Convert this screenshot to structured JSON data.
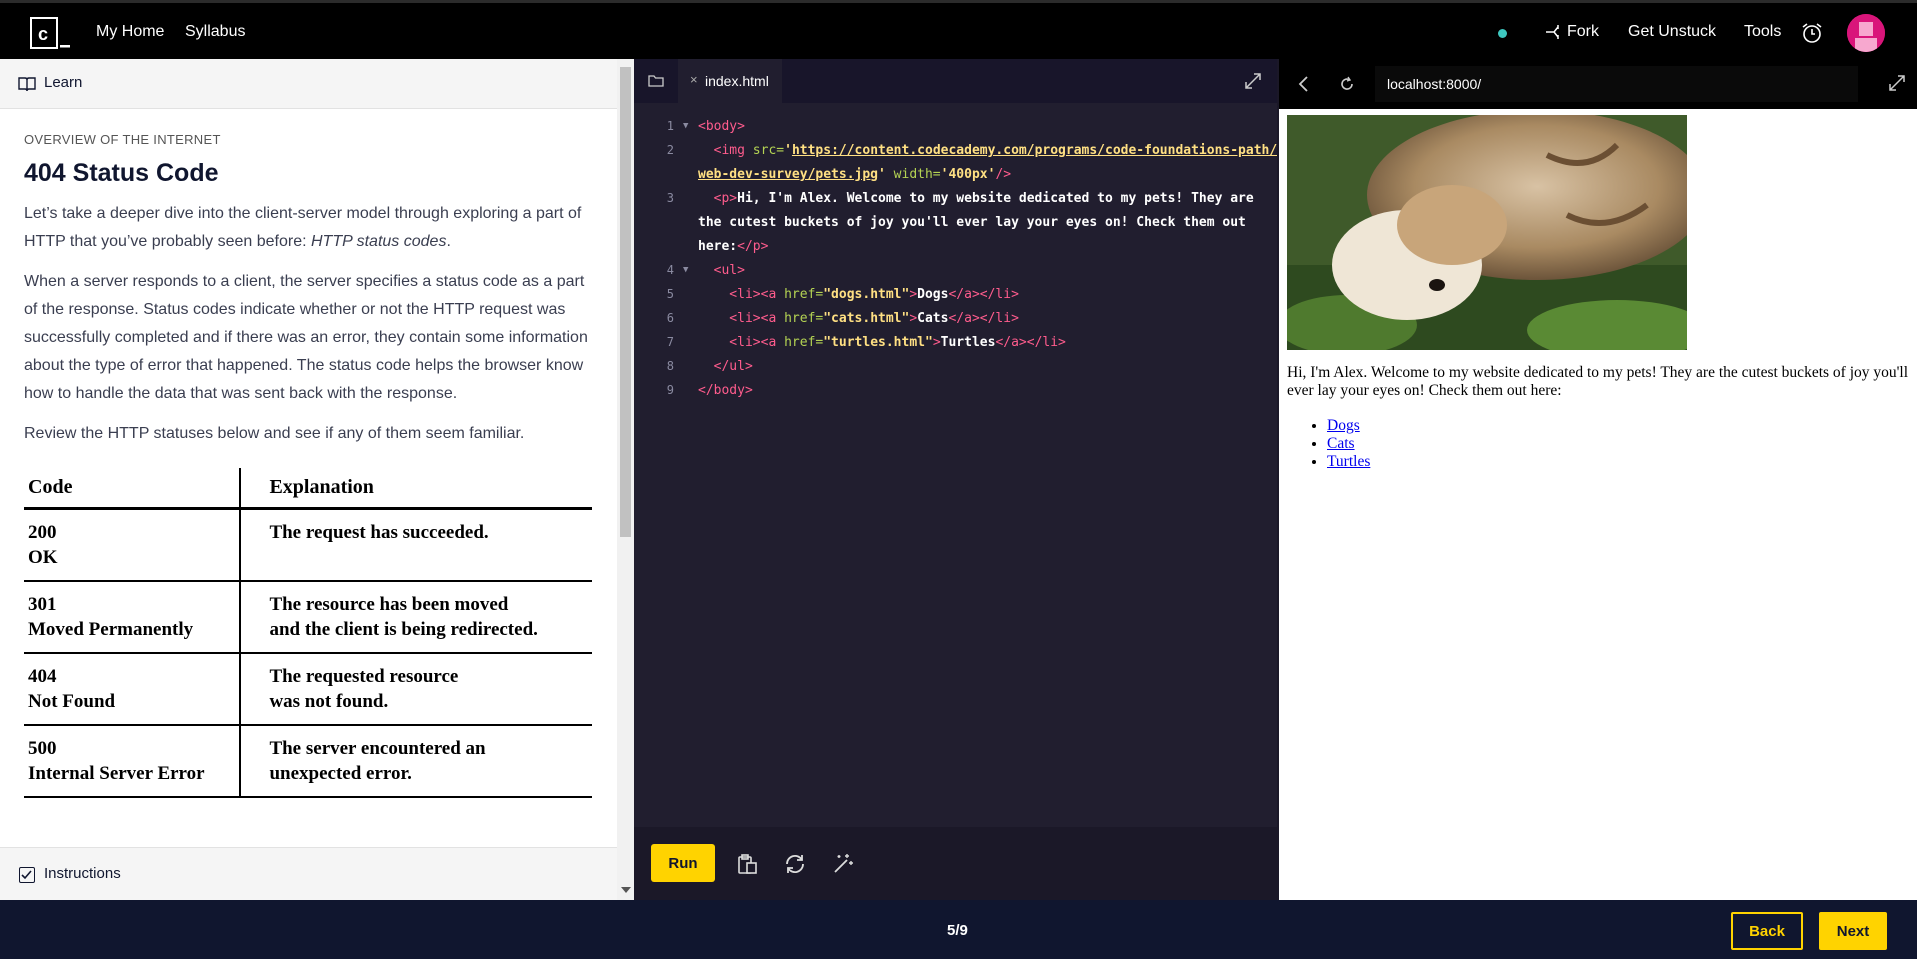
{
  "topbar": {
    "nav": {
      "home": "My Home",
      "syllabus": "Syllabus"
    },
    "actions": {
      "fork": "Fork",
      "unstuck": "Get Unstuck",
      "tools": "Tools"
    },
    "icons": [
      "codecademy-logo-icon",
      "fork-icon",
      "alarm-icon",
      "avatar"
    ],
    "status_color": "#3ec8c0"
  },
  "learn": {
    "header": "Learn",
    "section": "OVERVIEW OF THE INTERNET",
    "title": "404 Status Code",
    "para1_pre": "Let’s take a deeper dive into the client-server model through exploring a part of HTTP that you’ve probably seen before: ",
    "para1_em": "HTTP status codes",
    "para1_post": ".",
    "para2": "When a server responds to a client, the server specifies a status code as a part of the response. Status codes indicate whether or not the HTTP request was successfully completed and if there was an error, they contain some information about the type of error that happened. The status code helps the browser know how to handle the data that was sent back with the response.",
    "para3": "Review the HTTP statuses below and see if any of them seem familiar.",
    "table": {
      "headers": [
        "Code",
        "Explanation"
      ],
      "rows": [
        {
          "code": "200",
          "name": "OK",
          "exp1": "The request has succeeded.",
          "exp2": ""
        },
        {
          "code": "301",
          "name": "Moved Permanently",
          "exp1": "The resource has been moved",
          "exp2": "and the client is being redirected."
        },
        {
          "code": "404",
          "name": "Not Found",
          "exp1": "The requested resource",
          "exp2": "was not found."
        },
        {
          "code": "500",
          "name": "Internal Server Error",
          "exp1": "The server encountered an",
          "exp2": "unexpected error."
        }
      ]
    },
    "instructions": "Instructions"
  },
  "editor": {
    "tab": "index.html",
    "lines": [
      {
        "n": "1",
        "fold": true
      },
      {
        "n": "2",
        "fold": false
      },
      {
        "n": "",
        "fold": false
      },
      {
        "n": "3",
        "fold": false
      },
      {
        "n": "",
        "fold": false
      },
      {
        "n": "",
        "fold": false
      },
      {
        "n": "4",
        "fold": true
      },
      {
        "n": "5",
        "fold": false
      },
      {
        "n": "6",
        "fold": false
      },
      {
        "n": "7",
        "fold": false
      },
      {
        "n": "8",
        "fold": false
      },
      {
        "n": "9",
        "fold": false
      }
    ],
    "code": {
      "l1": "<body>",
      "l2_tag": "  <img ",
      "l2_attr": "src=",
      "l2_url": "https://content.codecademy.com/programs/code-foundations-path/",
      "l2b_url": "web-dev-survey/pets.jpg",
      "l2b_attr": " width=",
      "l2b_val": "'400px'",
      "l2b_end": "/>",
      "l3_tag": "  <p>",
      "l3_text": "Hi, I'm Alex. Welcome to my website dedicated to my pets! They are",
      "l3b_text": "the cutest buckets of joy you'll ever lay your eyes on! Check them out",
      "l3c_text": "here:",
      "l3c_tag": "</p>",
      "l4": "  <ul>",
      "li_open": "    <li><a ",
      "li_attr": "href=",
      "l5_href": "\"dogs.html\"",
      "l5_text": "Dogs",
      "l6_href": "\"cats.html\"",
      "l6_text": "Cats",
      "l7_href": "\"turtles.html\"",
      "l7_text": "Turtles",
      "li_close": "</a></li>",
      "l8": "  </ul>",
      "l9": "</body>"
    },
    "run_label": "Run",
    "tool_icons": [
      "copy-icon",
      "reset-icon",
      "magic-wand-icon"
    ]
  },
  "preview": {
    "url": "localhost:8000/",
    "paragraph": "Hi, I'm Alex. Welcome to my website dedicated to my pets! They are the cutest buckets of joy you'll ever lay your eyes on! Check them out here:",
    "links": [
      "Dogs",
      "Cats",
      "Turtles"
    ]
  },
  "bottom": {
    "progress": "5/9",
    "back": "Back",
    "next": "Next"
  },
  "colors": {
    "accent": "#ffd300",
    "navy": "#10162f",
    "editor_bg": "#211e2f",
    "tag": "#ff5c8d",
    "attr": "#b4d353",
    "string": "#ffe083"
  }
}
